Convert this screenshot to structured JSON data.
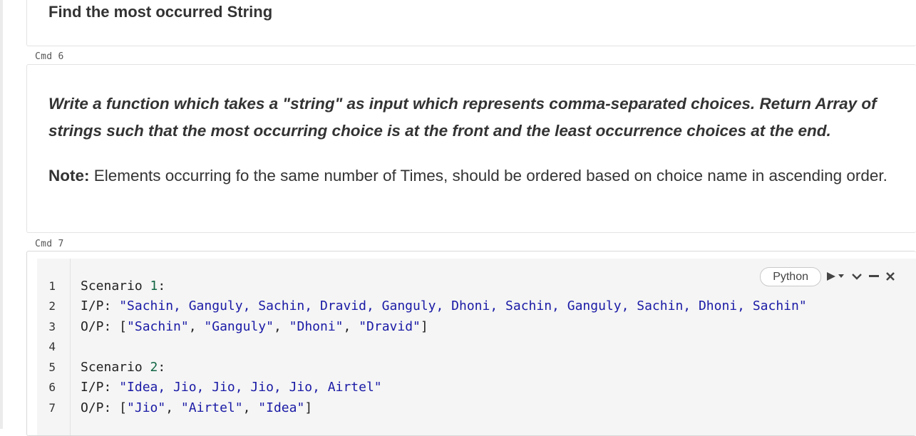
{
  "cells": {
    "cell1": {
      "heading": "Find the most occurred String"
    },
    "cmd6_label": "Cmd 6",
    "cell2": {
      "question": "Write a function which takes a \"string\" as input which represents comma-separated choices. Return Array of strings such that the most occurring choice is at the front and the least occurrence choices at the end.",
      "note_label": "Note:",
      "note_text": " Elements occurring fo the same number of Times, should be ordered based on choice name in ascending order."
    },
    "cmd7_label": "Cmd 7",
    "cell3": {
      "language": "Python",
      "toolbar_icons": [
        "run-icon",
        "run-dropdown-icon",
        "collapse-chevron-icon",
        "minimize-icon",
        "close-icon"
      ],
      "line_numbers": [
        "1",
        "2",
        "3",
        "4",
        "5",
        "6",
        "7"
      ],
      "lines": [
        {
          "prefix": "Scenario ",
          "num": "1",
          "suffix": ":"
        },
        {
          "prefix": "I/P: ",
          "str": "\"Sachin, Ganguly, Sachin, Dravid, Ganguly, Dhoni, Sachin, Ganguly, Sachin, Dhoni, Sachin\""
        },
        {
          "prefix": "O/P: [",
          "items": [
            "\"Sachin\"",
            "\"Ganguly\"",
            "\"Dhoni\"",
            "\"Dravid\""
          ],
          "suffix": "]"
        },
        {
          "prefix": ""
        },
        {
          "prefix": "Scenario ",
          "num": "2",
          "suffix": ":"
        },
        {
          "prefix": "I/P: ",
          "str": "\"Idea, Jio, Jio, Jio, Jio, Airtel\""
        },
        {
          "prefix": "O/P: [",
          "items": [
            "\"Jio\"",
            "\"Airtel\"",
            "\"Idea\""
          ],
          "suffix": "]"
        }
      ]
    }
  },
  "colors": {
    "string": "#1a1aa6",
    "number": "#116644",
    "editor_bg": "#f5f5f5"
  }
}
